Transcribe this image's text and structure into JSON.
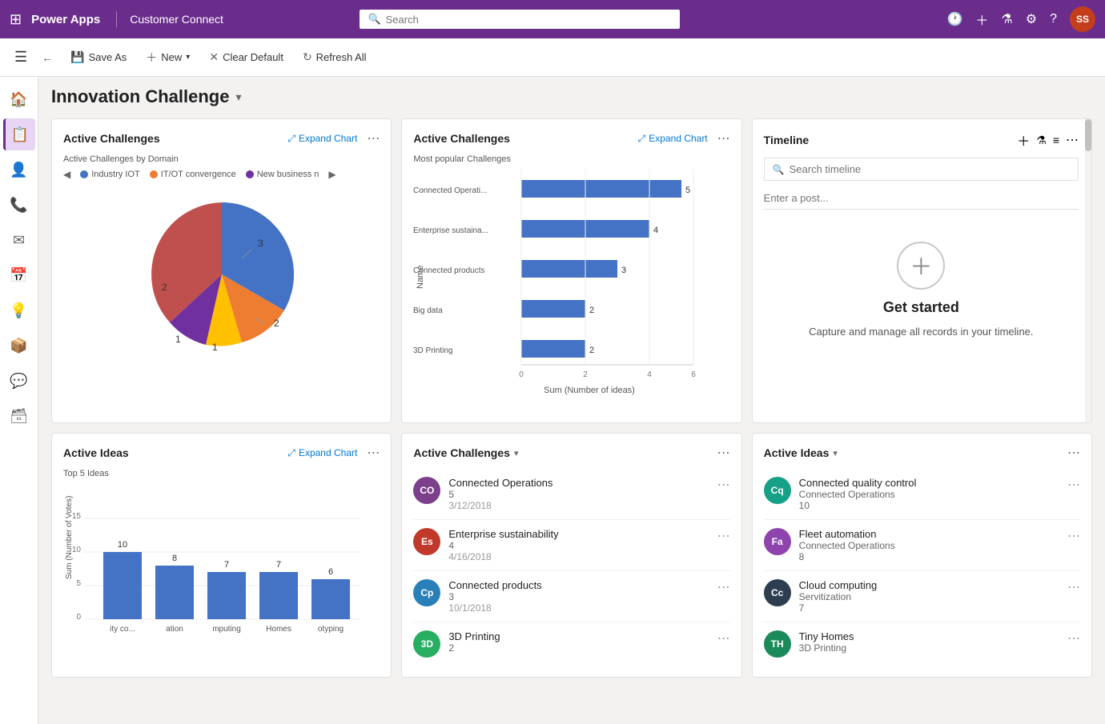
{
  "app": {
    "name": "Power Apps",
    "env": "Customer Connect",
    "search_placeholder": "Search",
    "avatar_initials": "SS"
  },
  "toolbar": {
    "save_as": "Save As",
    "new": "New",
    "clear_default": "Clear Default",
    "refresh_all": "Refresh All"
  },
  "page": {
    "title": "Innovation Challenge"
  },
  "sidebar": {
    "items": [
      "⊞",
      "🏠",
      "📋",
      "👤",
      "☎",
      "✉",
      "📅",
      "💡",
      "📦",
      "💬",
      "📦"
    ]
  },
  "pie_chart": {
    "title": "Active Challenges",
    "subtitle": "Active Challenges by Domain",
    "expand": "Expand Chart",
    "legend": [
      {
        "label": "Industry IOT",
        "color": "#4472c4"
      },
      {
        "label": "IT/OT convergence",
        "color": "#ed7d31"
      },
      {
        "label": "New business n",
        "color": "#7030a0"
      }
    ],
    "slices": [
      {
        "value": 3,
        "color": "#4472c4",
        "label": "3"
      },
      {
        "value": 2,
        "color": "#ed7d31",
        "label": "2"
      },
      {
        "value": 1,
        "color": "#ffc000",
        "label": "1"
      },
      {
        "value": 1,
        "color": "#7030a0",
        "label": "1"
      },
      {
        "value": 2,
        "color": "#c0504d",
        "label": "2"
      }
    ]
  },
  "bar_chart": {
    "title": "Active Challenges",
    "subtitle": "Most popular Challenges",
    "expand": "Expand Chart",
    "x_label": "Sum (Number of ideas)",
    "y_label": "Name",
    "bars": [
      {
        "name": "Connected Operati...",
        "value": 5
      },
      {
        "name": "Enterprise sustaina...",
        "value": 4
      },
      {
        "name": "Connected products",
        "value": 3
      },
      {
        "name": "Big data",
        "value": 2
      },
      {
        "name": "3D Printing",
        "value": 2
      }
    ],
    "x_ticks": [
      0,
      2,
      4,
      6
    ]
  },
  "timeline": {
    "title": "Timeline",
    "search_placeholder": "Search timeline",
    "post_placeholder": "Enter a post...",
    "get_started_title": "Get started",
    "get_started_sub": "Capture and manage all records in your timeline."
  },
  "active_ideas_chart": {
    "title": "Active Ideas",
    "subtitle": "Top 5 Ideas",
    "expand": "Expand Chart",
    "y_label": "Sum (Number of Votes)",
    "bars": [
      {
        "name": "ity co...",
        "value": 10
      },
      {
        "name": "ation",
        "value": 8
      },
      {
        "name": "mputing",
        "value": 7
      },
      {
        "name": "Homes",
        "value": 7
      },
      {
        "name": "otyping",
        "value": 6
      }
    ],
    "y_ticks": [
      0,
      5,
      10,
      15
    ]
  },
  "active_challenges_list": {
    "title": "Active Challenges",
    "items": [
      {
        "initials": "CO",
        "color": "#7b3f8c",
        "name": "Connected Operations",
        "count": 5,
        "date": "3/12/2018"
      },
      {
        "initials": "Es",
        "color": "#c0392b",
        "name": "Enterprise sustainability",
        "count": 4,
        "date": "4/16/2018"
      },
      {
        "initials": "Cp",
        "color": "#2980b9",
        "name": "Connected products",
        "count": 3,
        "date": "10/1/2018"
      },
      {
        "initials": "3D",
        "color": "#27ae60",
        "name": "3D Printing",
        "count": 2,
        "date": ""
      }
    ]
  },
  "active_ideas_list": {
    "title": "Active Ideas",
    "items": [
      {
        "initials": "Cq",
        "color": "#16a085",
        "name": "Connected quality control",
        "sub": "Connected Operations",
        "count": 10
      },
      {
        "initials": "Fa",
        "color": "#8e44ad",
        "name": "Fleet automation",
        "sub": "Connected Operations",
        "count": 8
      },
      {
        "initials": "Cc",
        "color": "#2c3e50",
        "name": "Cloud computing",
        "sub": "Servitization",
        "count": 7
      },
      {
        "initials": "TH",
        "color": "#1a8a5a",
        "name": "Tiny Homes",
        "sub": "3D Printing",
        "count": ""
      }
    ]
  }
}
